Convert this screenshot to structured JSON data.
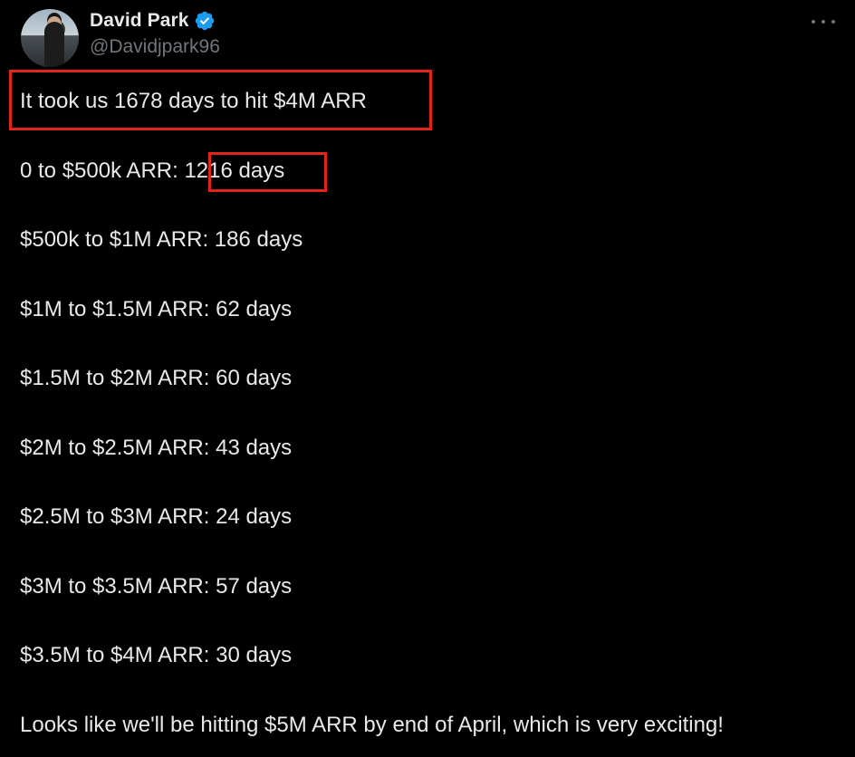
{
  "author": {
    "name": "David Park",
    "handle": "@Davidjpark96",
    "verified": true
  },
  "icons": {
    "avatar": "profile-photo",
    "verified": "verified-badge-icon",
    "more": "more-options-icon"
  },
  "colors": {
    "background": "#000000",
    "text": "#e7e9ea",
    "muted": "#71767b",
    "verified_badge": "#1d9bf0",
    "highlight_box": "#e3241b"
  },
  "tweet": {
    "lines": [
      "It took us 1678 days to hit $4M ARR",
      "0 to $500k ARR: 1216 days",
      "$500k to $1M ARR: 186 days",
      "$1M to $1.5M ARR: 62 days",
      "$1.5M to $2M ARR: 60 days",
      "$2M to $2.5M ARR: 43 days",
      "$2.5M to $3M ARR: 24 days",
      "$3M to $3.5M ARR: 57 days",
      "$3.5M to $4M ARR: 30 days",
      "Looks like we'll be hitting $5M ARR by end of April, which is very exciting!"
    ]
  }
}
